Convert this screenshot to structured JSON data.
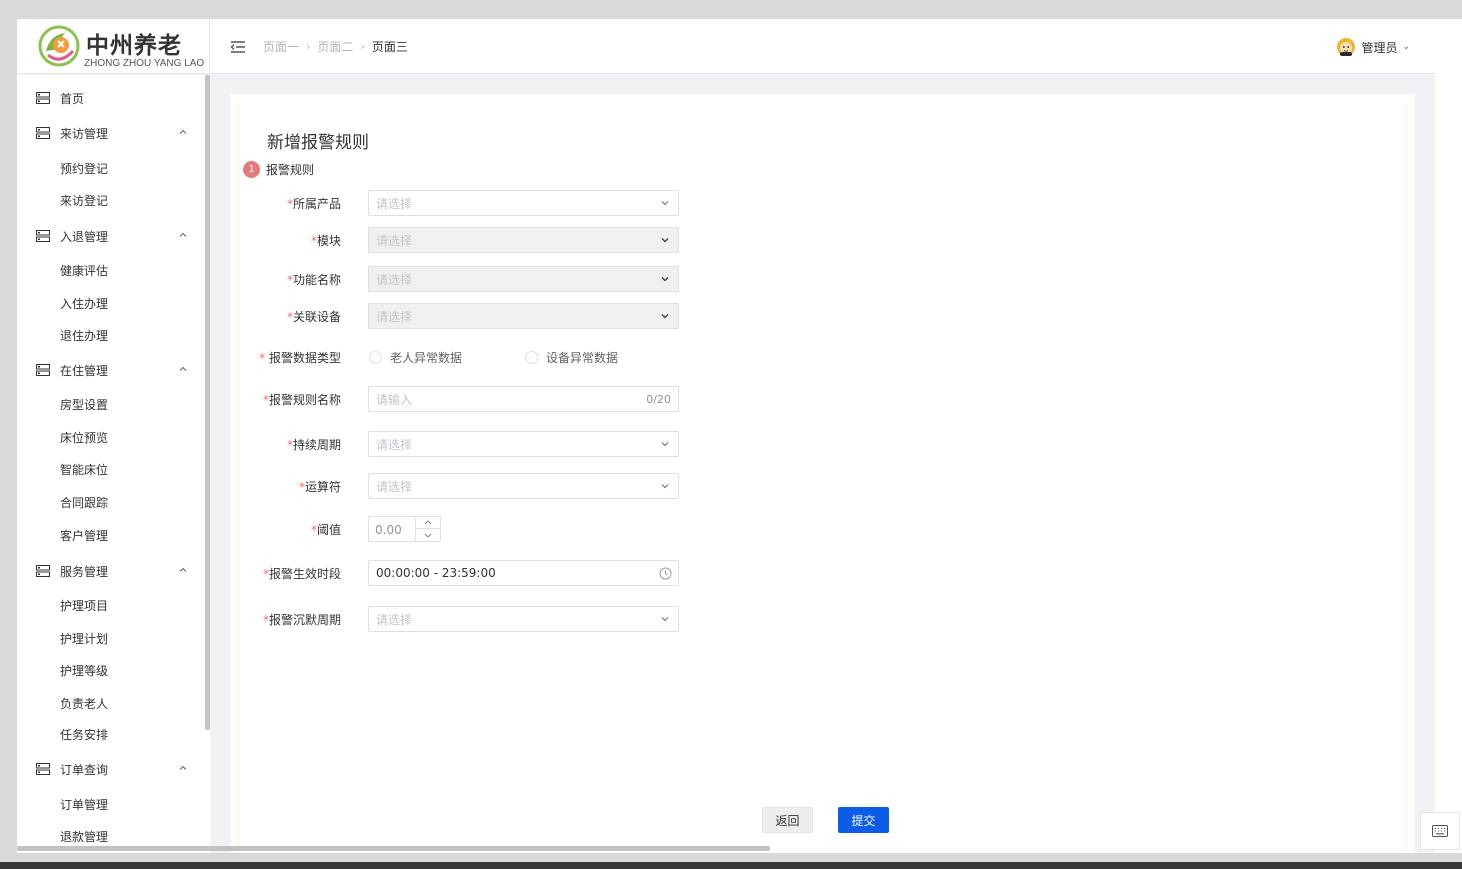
{
  "brand": {
    "title": "中州养老",
    "subtitle": "ZHONG ZHOU YANG LAO"
  },
  "breadcrumb": [
    "页面一",
    "页面二",
    "页面三"
  ],
  "user": {
    "name": "管理员"
  },
  "sidebar": {
    "items": [
      {
        "label": "首页"
      },
      {
        "label": "来访管理",
        "children": [
          "预约登记",
          "来访登记"
        ]
      },
      {
        "label": "入退管理",
        "children": [
          "健康评估",
          "入住办理",
          "退住办理"
        ]
      },
      {
        "label": "在住管理",
        "children": [
          "房型设置",
          "床位预览",
          "智能床位",
          "合同跟踪",
          "客户管理"
        ]
      },
      {
        "label": "服务管理",
        "children": [
          "护理项目",
          "护理计划",
          "护理等级",
          "负责老人",
          "任务安排"
        ]
      },
      {
        "label": "订单查询",
        "children": [
          "订单管理",
          "退款管理"
        ]
      }
    ]
  },
  "form": {
    "title": "新增报警规则",
    "step": {
      "number": "1",
      "label": "报警规则"
    },
    "fields": {
      "product": {
        "label": "所属产品",
        "placeholder": "请选择"
      },
      "module": {
        "label": "模块",
        "placeholder": "请选择"
      },
      "function_name": {
        "label": "功能名称",
        "placeholder": "请选择"
      },
      "device": {
        "label": "关联设备",
        "placeholder": "请选择"
      },
      "data_type": {
        "label": "报警数据类型",
        "options": [
          "老人异常数据",
          "设备异常数据"
        ]
      },
      "rule_name": {
        "label": "报警规则名称",
        "placeholder": "请输入",
        "count": "0/20"
      },
      "period": {
        "label": "持续周期",
        "placeholder": "请选择"
      },
      "operator": {
        "label": "运算符",
        "placeholder": "请选择"
      },
      "threshold": {
        "label": "阈值",
        "value": "0.00"
      },
      "effective_time": {
        "label": "报警生效时段",
        "value": "00:00:00 - 23:59:00"
      },
      "silence_period": {
        "label": "报警沉默周期",
        "placeholder": "请选择"
      }
    },
    "actions": {
      "back": "返回",
      "submit": "提交"
    }
  }
}
